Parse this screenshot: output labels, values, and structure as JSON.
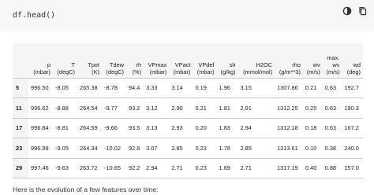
{
  "code_cell": {
    "code": "df.head()",
    "toolbar_icons": [
      "theme-toggle-icon",
      "copy-icon"
    ]
  },
  "table": {
    "columns": [
      "p\n(mbar)",
      "T\n(degC)",
      "Tpot\n(K)",
      "Tdew\n(degC)",
      "rh\n(%)",
      "VPmax\n(mbar)",
      "VPact\n(mbar)",
      "VPdef\n(mbar)",
      "sh\n(g/kg)",
      "H2OC\n(mmol/mol)",
      "rho\n(g/m**3)",
      "wv\n(m/s)",
      "max.\nwv\n(m/s)",
      "wd\n(deg)"
    ],
    "rows": [
      {
        "index": "5",
        "values": [
          "996.50",
          "-8.05",
          "265.38",
          "-8.78",
          "94.4",
          "3.33",
          "3.14",
          "0.19",
          "1.96",
          "3.15",
          "1307.86",
          "0.21",
          "0.63",
          "192.7"
        ]
      },
      {
        "index": "11",
        "values": [
          "996.62",
          "-8.88",
          "264.54",
          "-9.77",
          "93.2",
          "3.12",
          "2.90",
          "0.21",
          "1.81",
          "2.91",
          "1312.25",
          "0.25",
          "0.63",
          "190.3"
        ]
      },
      {
        "index": "17",
        "values": [
          "996.84",
          "-8.81",
          "264.59",
          "-9.66",
          "93.5",
          "3.13",
          "2.93",
          "0.20",
          "1.83",
          "2.94",
          "1312.18",
          "0.18",
          "0.63",
          "167.2"
        ]
      },
      {
        "index": "23",
        "values": [
          "996.99",
          "-9.05",
          "264.34",
          "-10.02",
          "92.6",
          "3.07",
          "2.85",
          "0.23",
          "1.78",
          "2.85",
          "1313.61",
          "0.10",
          "0.38",
          "240.0"
        ]
      },
      {
        "index": "29",
        "values": [
          "997.46",
          "-9.63",
          "263.72",
          "-10.65",
          "92.2",
          "2.94",
          "2.71",
          "0.23",
          "1.69",
          "2.71",
          "1317.19",
          "0.40",
          "0.88",
          "157.0"
        ]
      }
    ]
  },
  "caption": "Here is the evolution of a few features over time:"
}
